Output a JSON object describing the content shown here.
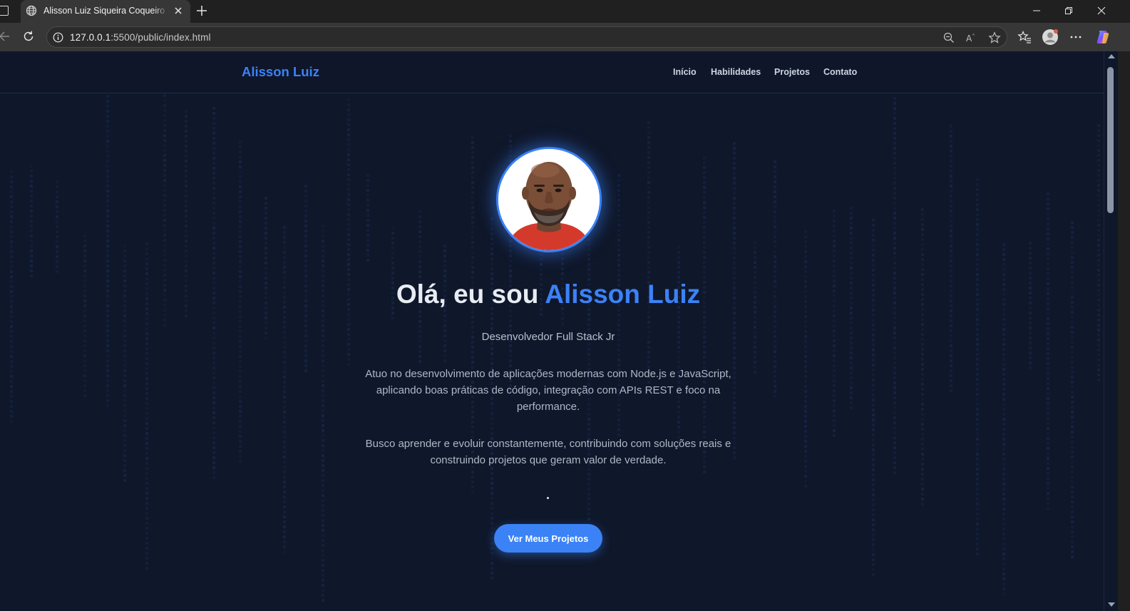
{
  "browser": {
    "tab_title": "Alisson Luiz Siqueira Coqueiro | Desenvolvedor Full Stack",
    "url_host": "127.0.0.1",
    "url_rest": ":5500/public/index.html"
  },
  "site": {
    "logo": "Alisson Luiz",
    "nav": [
      "Início",
      "Habilidades",
      "Projetos",
      "Contato"
    ]
  },
  "hero": {
    "greeting": "Olá, eu sou ",
    "name": "Alisson Luiz",
    "role": "Desenvolvedor Full Stack Jr",
    "paragraph_1": "Atuo no desenvolvimento de aplicações modernas com Node.js e JavaScript, aplicando boas práticas de código, integração com APIs REST e foco na performance.",
    "paragraph_2": "Busco aprender e evoluir constantemente, contribuindo com soluções reais e construindo projetos que geram valor de verdade.",
    "cta_label": "Ver Meus Projetos"
  },
  "colors": {
    "background": "#0f172a",
    "accent": "#3b82f6",
    "text": "#e8ecf3",
    "muted": "#aeb8c6"
  }
}
